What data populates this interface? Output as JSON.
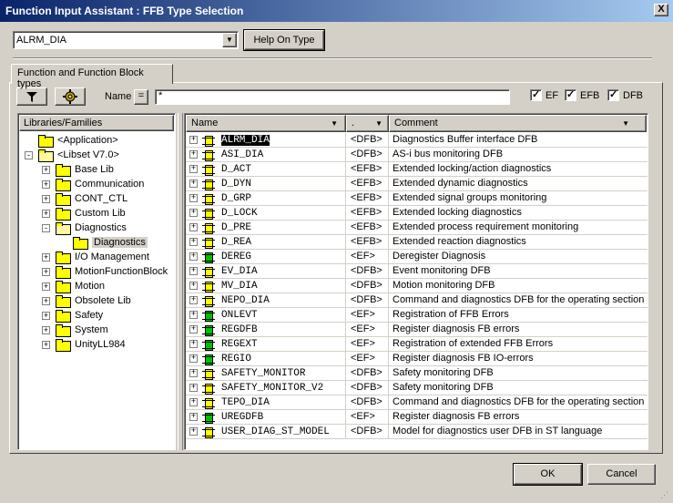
{
  "window": {
    "title": "Function Input Assistant : FFB Type Selection",
    "close_glyph": "X"
  },
  "type_combo": {
    "value": "ALRM_DIA"
  },
  "help_button": {
    "label": "Help On Type"
  },
  "tab": {
    "label": "Function and Function Block types"
  },
  "filter": {
    "name_label": "Name",
    "eq_label": "=",
    "name_value": "*"
  },
  "checkboxes": [
    {
      "label": "EF",
      "checked": true
    },
    {
      "label": "EFB",
      "checked": true
    },
    {
      "label": "DFB",
      "checked": true
    }
  ],
  "tree": {
    "header": "Libraries/Families",
    "items": [
      {
        "label": "<Application>",
        "level": 0,
        "expander": ""
      },
      {
        "label": "<Libset V7.0>",
        "level": 0,
        "expander": "-"
      },
      {
        "label": "Base Lib",
        "level": 1,
        "expander": "+"
      },
      {
        "label": "Communication",
        "level": 1,
        "expander": "+"
      },
      {
        "label": "CONT_CTL",
        "level": 1,
        "expander": "+"
      },
      {
        "label": "Custom Lib",
        "level": 1,
        "expander": "+"
      },
      {
        "label": "Diagnostics",
        "level": 1,
        "expander": "-"
      },
      {
        "label": "Diagnostics",
        "level": 2,
        "expander": "",
        "selected": true
      },
      {
        "label": "I/O Management",
        "level": 1,
        "expander": "+"
      },
      {
        "label": "MotionFunctionBlock",
        "level": 1,
        "expander": "+"
      },
      {
        "label": "Motion",
        "level": 1,
        "expander": "+"
      },
      {
        "label": "Obsolete Lib",
        "level": 1,
        "expander": "+"
      },
      {
        "label": "Safety",
        "level": 1,
        "expander": "+"
      },
      {
        "label": "System",
        "level": 1,
        "expander": "+"
      },
      {
        "label": "UnityLL984",
        "level": 1,
        "expander": "+"
      }
    ]
  },
  "grid": {
    "columns": [
      {
        "label": "Name"
      },
      {
        "label": "."
      },
      {
        "label": "Comment"
      }
    ],
    "rows": [
      {
        "name": "ALRM_DIA",
        "kind": "<DFB>",
        "comment": "Diagnostics Buffer interface DFB",
        "selected": true
      },
      {
        "name": "ASI_DIA",
        "kind": "<DFB>",
        "comment": "AS-i bus monitoring DFB"
      },
      {
        "name": "D_ACT",
        "kind": "<EFB>",
        "comment": "Extended locking/action diagnostics"
      },
      {
        "name": "D_DYN",
        "kind": "<EFB>",
        "comment": "Extended dynamic diagnostics"
      },
      {
        "name": "D_GRP",
        "kind": "<EFB>",
        "comment": "Extended signal groups monitoring"
      },
      {
        "name": "D_LOCK",
        "kind": "<EFB>",
        "comment": "Extended locking diagnostics"
      },
      {
        "name": "D_PRE",
        "kind": "<EFB>",
        "comment": "Extended process requirement monitoring"
      },
      {
        "name": "D_REA",
        "kind": "<EFB>",
        "comment": "Extended reaction diagnostics"
      },
      {
        "name": "DEREG",
        "kind": "<EF>",
        "comment": "Deregister Diagnosis"
      },
      {
        "name": "EV_DIA",
        "kind": "<DFB>",
        "comment": "Event monitoring DFB"
      },
      {
        "name": "MV_DIA",
        "kind": "<DFB>",
        "comment": "Motion monitoring DFB"
      },
      {
        "name": "NEPO_DIA",
        "kind": "<DFB>",
        "comment": "Command and diagnostics DFB for the operating section"
      },
      {
        "name": "ONLEVT",
        "kind": "<EF>",
        "comment": "Registration of FFB Errors"
      },
      {
        "name": "REGDFB",
        "kind": "<EF>",
        "comment": "Register diagnosis FB errors"
      },
      {
        "name": "REGEXT",
        "kind": "<EF>",
        "comment": "Registration of extended FFB Errors"
      },
      {
        "name": "REGIO",
        "kind": "<EF>",
        "comment": "Register diagnosis FB IO-errors"
      },
      {
        "name": "SAFETY_MONITOR",
        "kind": "<DFB>",
        "comment": "Safety monitoring DFB"
      },
      {
        "name": "SAFETY_MONITOR_V2",
        "kind": "<DFB>",
        "comment": "Safety monitoring DFB"
      },
      {
        "name": "TEPO_DIA",
        "kind": "<DFB>",
        "comment": "Command and diagnostics DFB for the operating section"
      },
      {
        "name": "UREGDFB",
        "kind": "<EF>",
        "comment": "Register diagnosis FB errors"
      },
      {
        "name": "USER_DIAG_ST_MODEL",
        "kind": "<DFB>",
        "comment": "Model for diagnostics user DFB in ST language"
      }
    ]
  },
  "buttons": {
    "ok": "OK",
    "cancel": "Cancel"
  },
  "colors": {
    "title_start": "#0a246a",
    "title_end": "#a6caf0",
    "dfb_icon": "#ffff00",
    "ef_icon": "#00c000"
  },
  "icons": {
    "filter": "funnel-icon",
    "gear": "gear-icon",
    "folder": "folder-icon",
    "block": "function-block-icon"
  }
}
